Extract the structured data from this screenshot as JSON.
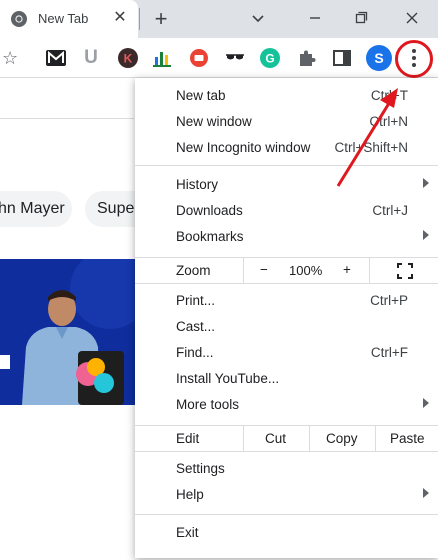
{
  "tab": {
    "title": "New Tab",
    "close_glyph": "✕"
  },
  "toolbar": {
    "profile_initial": "S",
    "extensions": [
      {
        "name": "m-extension-icon",
        "glyph": "M",
        "color": "#202124"
      },
      {
        "name": "u-extension-icon",
        "glyph": "U",
        "color": "#9aa0a6"
      },
      {
        "name": "k-extension-icon",
        "glyph": "K",
        "color": "#ffffff"
      },
      {
        "name": "chart-extension-icon",
        "glyph": "",
        "color": "#188038"
      },
      {
        "name": "red-circle-extension-icon",
        "glyph": "",
        "color": "#ea4335"
      },
      {
        "name": "glasses-extension-icon",
        "glyph": "",
        "color": "#202124"
      },
      {
        "name": "grammarly-icon",
        "glyph": "G",
        "color": "#ffffff"
      }
    ]
  },
  "page": {
    "chip_left": "hn Mayer",
    "chip_right": "Supe"
  },
  "menu": {
    "items_top": [
      {
        "label": "New tab",
        "shortcut": "Ctrl+T"
      },
      {
        "label": "New window",
        "shortcut": "Ctrl+N"
      },
      {
        "label": "New Incognito window",
        "shortcut": "Ctrl+Shift+N"
      }
    ],
    "items_history": [
      {
        "label": "History",
        "shortcut": "",
        "submenu": true
      },
      {
        "label": "Downloads",
        "shortcut": "Ctrl+J",
        "submenu": false
      },
      {
        "label": "Bookmarks",
        "shortcut": "",
        "submenu": true
      }
    ],
    "zoom": {
      "label": "Zoom",
      "minus": "−",
      "value": "100%",
      "plus": "+"
    },
    "items_print": [
      {
        "label": "Print...",
        "shortcut": "Ctrl+P",
        "submenu": false
      },
      {
        "label": "Cast...",
        "shortcut": "",
        "submenu": false
      },
      {
        "label": "Find...",
        "shortcut": "Ctrl+F",
        "submenu": false
      },
      {
        "label": "Install YouTube...",
        "shortcut": "",
        "submenu": false
      },
      {
        "label": "More tools",
        "shortcut": "",
        "submenu": true
      }
    ],
    "edit": {
      "label": "Edit",
      "cut": "Cut",
      "copy": "Copy",
      "paste": "Paste"
    },
    "items_settings": [
      {
        "label": "Settings",
        "submenu": false
      },
      {
        "label": "Help",
        "submenu": true
      }
    ],
    "exit_label": "Exit"
  },
  "colors": {
    "annotation_red": "#e0171e",
    "tabstrip_bg": "#dee1e6",
    "profile_blue": "#1a73e8",
    "banner_blue": "#0f2d9c"
  }
}
